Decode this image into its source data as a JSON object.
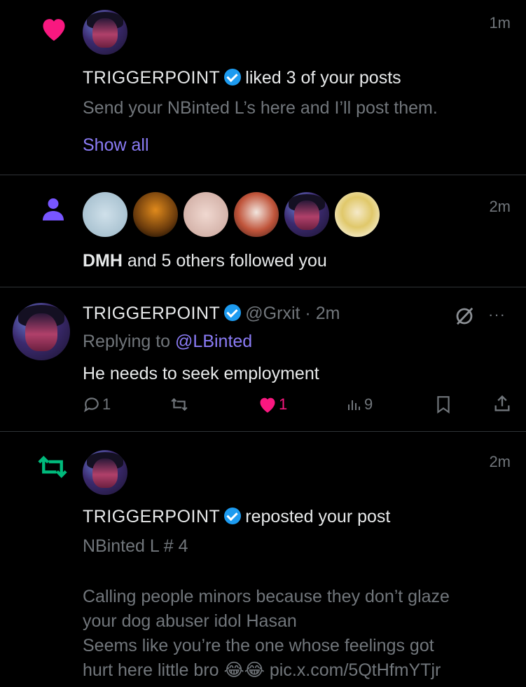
{
  "like_notification": {
    "name": "TRIGGERPOINT",
    "action": "liked 3 of your posts",
    "preview": "Send your NBinted L’s here and I’ll post them.",
    "show_all": "Show all",
    "time": "1m"
  },
  "follow_notification": {
    "text_name": "DMH",
    "text_rest": "and 5 others followed you",
    "time": "2m"
  },
  "reply_post": {
    "name": "TRIGGERPOINT",
    "handle": "@Grxit",
    "separator": "·",
    "time": "2m",
    "replying_label": "Replying to",
    "replying_to": "@LBinted",
    "body": "He needs to seek employment",
    "actions": {
      "replies": "1",
      "reposts": "",
      "likes": "1",
      "views": "9"
    },
    "more": "···"
  },
  "repost_notification": {
    "name": "TRIGGERPOINT",
    "action": "reposted your post",
    "time": "2m",
    "post_title": "NBinted L # 4",
    "post_line1": "Calling people minors because they don’t glaze",
    "post_line2": "your dog abuser idol Hasan",
    "post_line3": "Seems like you’re the one whose feelings got",
    "post_line4": "hurt here little bro",
    "post_emoji": "😂😂",
    "post_link": "pic.x.com/5QtHfmYTjr"
  },
  "colors": {
    "like": "#f91880",
    "follow": "#7856ff",
    "repost": "#00ba7c",
    "verified": "#1d9bf0",
    "link": "#8b7cf6"
  }
}
